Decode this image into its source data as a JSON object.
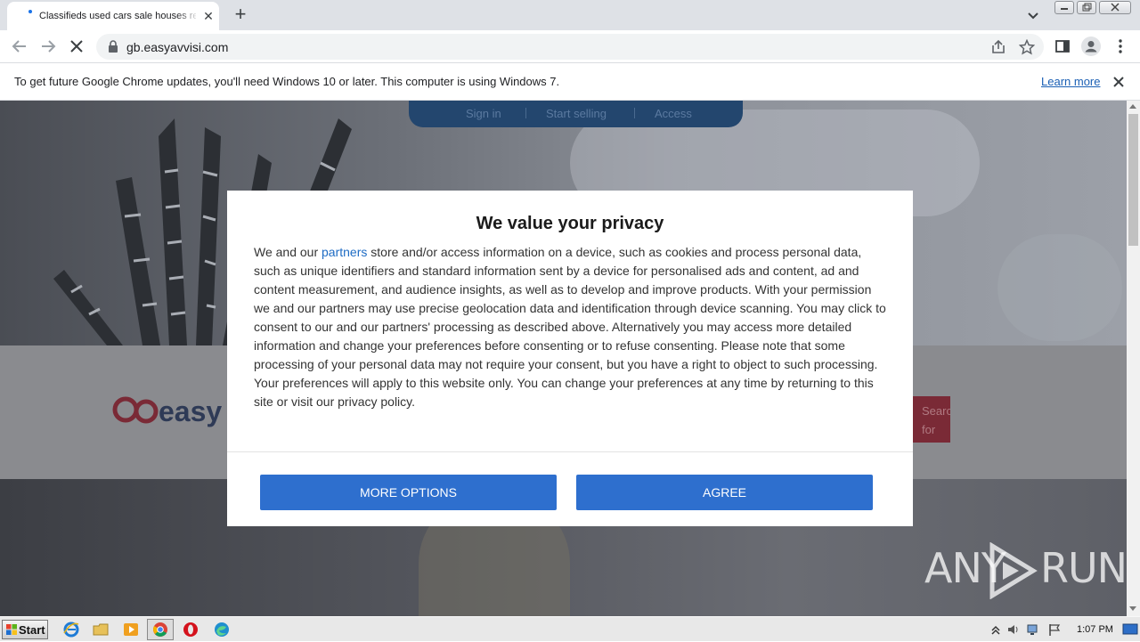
{
  "browser": {
    "tab": {
      "title": "Classifieds used cars sale houses rent"
    },
    "address": {
      "url": "gb.easyavvisi.com"
    }
  },
  "infobar": {
    "message": "To get future Google Chrome updates, you'll need Windows 10 or later. This computer is using Windows 7.",
    "learn_more": "Learn more"
  },
  "site": {
    "nav": {
      "sign_in": "Sign in",
      "start_selling": "Start selling",
      "access": "Access"
    },
    "search_button": {
      "line1": "Search",
      "line2": "for"
    }
  },
  "consent": {
    "title": "We value your privacy",
    "body_before_link": "We and our ",
    "link_text": "partners",
    "body_after_link": " store and/or access information on a device, such as cookies and process personal data, such as unique identifiers and standard information sent by a device for personalised ads and content, ad and content measurement, and audience insights, as well as to develop and improve products. With your permission we and our partners may use precise geolocation data and identification through device scanning. You may click to consent to our and our partners' processing as described above. Alternatively you may access more detailed information and change your preferences before consenting or to refuse consenting. Please note that some processing of your personal data may not require your consent, but you have a right to object to such processing. Your preferences will apply to this website only. You can change your preferences at any time by returning to this site or visit our privacy policy.",
    "more_options": "MORE OPTIONS",
    "agree": "AGREE"
  },
  "watermark": {
    "left": "ANY",
    "right": "RUN"
  },
  "taskbar": {
    "start": "Start",
    "clock": "1:07 PM"
  },
  "colors": {
    "consent_button": "#2e6fce",
    "site_nav": "#23466e",
    "link": "#1a5fb4"
  },
  "icons": [
    "favicon-loading-icon",
    "close-icon",
    "new-tab-icon",
    "tab-search-icon",
    "back-icon",
    "forward-icon",
    "stop-icon",
    "lock-icon",
    "share-icon",
    "star-icon",
    "side-panel-icon",
    "profile-icon",
    "menu-icon",
    "ie-icon",
    "folder-icon",
    "media-player-icon",
    "chrome-icon",
    "opera-icon",
    "edge-icon",
    "flag-icon",
    "volume-icon",
    "network-icon"
  ]
}
